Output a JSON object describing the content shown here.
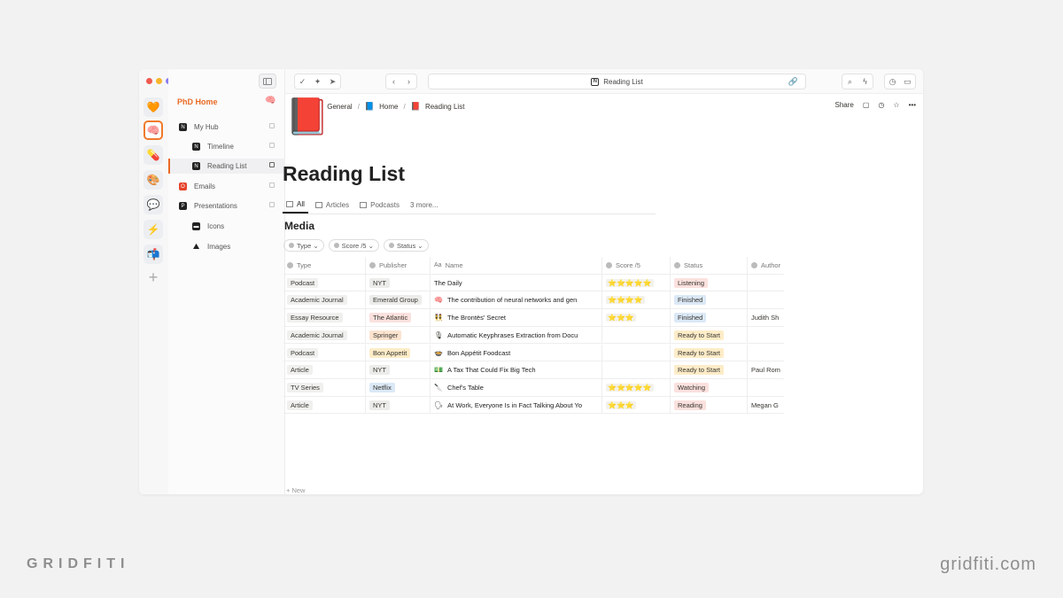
{
  "window": {
    "traffic_lights": [
      "#f05a4f",
      "#f7b52b",
      "#8a7cf0"
    ],
    "address": "Reading List"
  },
  "rail": {
    "items": [
      {
        "name": "heart",
        "glyph": "🧡"
      },
      {
        "name": "brain",
        "glyph": "🧠"
      },
      {
        "name": "pill",
        "glyph": "💊"
      },
      {
        "name": "palette",
        "glyph": "🎨"
      },
      {
        "name": "speech",
        "glyph": "💬"
      },
      {
        "name": "bolt",
        "glyph": "⚡"
      },
      {
        "name": "mailbox",
        "glyph": "📬"
      }
    ],
    "add": "+"
  },
  "sidebar": {
    "workspace": "PhD Home",
    "workspace_icon": "🧠",
    "items": [
      {
        "label": "My Hub"
      },
      {
        "label": "Timeline"
      },
      {
        "label": "Reading List"
      },
      {
        "label": "Emails"
      },
      {
        "label": "Presentations"
      },
      {
        "label": "Icons"
      },
      {
        "label": "Images"
      }
    ]
  },
  "breadcrumb": {
    "items": [
      {
        "icon": "🏫",
        "label": "General"
      },
      {
        "icon": "📘",
        "label": "Home"
      },
      {
        "icon": "📕",
        "label": "Reading List"
      }
    ],
    "separator": "/"
  },
  "header_actions": {
    "share": "Share"
  },
  "page": {
    "icon": "📕",
    "title": "Reading List",
    "tabs": [
      "All",
      "Articles",
      "Podcasts",
      "3 more..."
    ],
    "group": "Media",
    "filters": [
      "Type",
      "Score /5",
      "Status"
    ]
  },
  "table": {
    "columns": [
      "Type",
      "Publisher",
      "Name",
      "Score /5",
      "Status",
      "Author"
    ],
    "rows": [
      {
        "type": "Podcast",
        "publisher": "NYT",
        "name_icon": "",
        "name": "The Daily",
        "score": "⭐⭐⭐⭐⭐",
        "status": "Listening",
        "author": ""
      },
      {
        "type": "Academic Journal",
        "publisher": "Emerald Group",
        "name_icon": "🧠",
        "name": "The contribution of neural networks and gen",
        "score": "⭐⭐⭐⭐",
        "status": "Finished",
        "author": ""
      },
      {
        "type": "Essay Resource",
        "publisher": "The Atlantic",
        "name_icon": "👯",
        "name": "The Brontës' Secret",
        "score": "⭐⭐⭐",
        "status": "Finished",
        "author": "Judith Sh"
      },
      {
        "type": "Academic Journal",
        "publisher": "Springer",
        "name_icon": "🎙",
        "name": "Automatic Keyphrases Extraction from Docu",
        "score": "",
        "status": "Ready to Start",
        "author": ""
      },
      {
        "type": "Podcast",
        "publisher": "Bon Appetit",
        "name_icon": "🍲",
        "name": "Bon Appétit Foodcast",
        "score": "",
        "status": "Ready to Start",
        "author": ""
      },
      {
        "type": "Article",
        "publisher": "NYT",
        "name_icon": "💵",
        "name": "A Tax That Could Fix Big Tech",
        "score": "",
        "status": "Ready to Start",
        "author": "Paul Rom"
      },
      {
        "type": "TV Series",
        "publisher": "Netflix",
        "name_icon": "🔪",
        "name": "Chef's Table",
        "score": "⭐⭐⭐⭐⭐",
        "status": "Watching",
        "author": ""
      },
      {
        "type": "Article",
        "publisher": "NYT",
        "name_icon": "🗣",
        "name": "At Work, Everyone Is in Fact Talking About Yo",
        "score": "⭐⭐⭐",
        "status": "Reading",
        "author": "Megan G"
      }
    ],
    "new_label": "+ New"
  },
  "tag_colors": {
    "NYT": "#ececea",
    "Emerald Group": "#ececea",
    "The Atlantic": "#fbe1de",
    "Springer": "#fbe3cf",
    "Bon Appetit": "#fdecc8",
    "Netflix": "#dbe8f6",
    "Listening": "#fbe1de",
    "Finished": "#dbe8f6",
    "Ready to Start": "#fdecc8",
    "Watching": "#fbe1de",
    "Reading": "#fbe1de",
    "type": "#f0f0ef"
  },
  "branding": {
    "left": "GRIDFITI",
    "right": "gridfiti.com"
  }
}
